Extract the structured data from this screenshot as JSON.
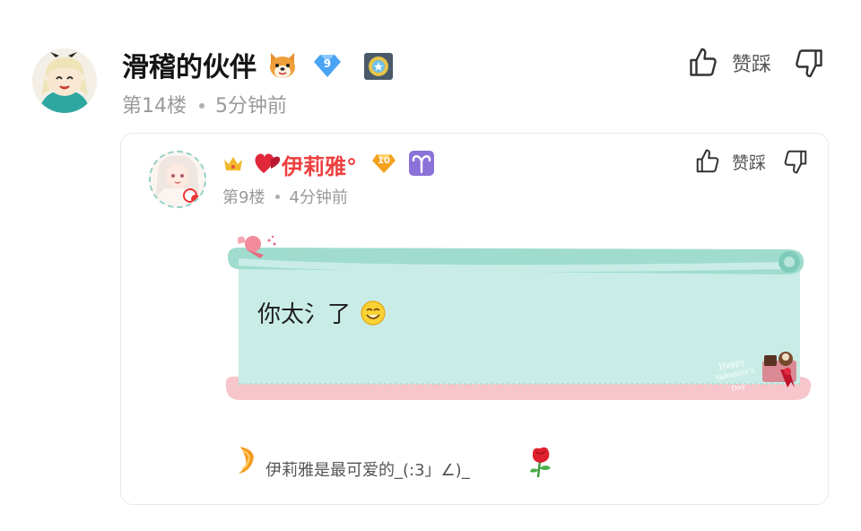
{
  "post": {
    "username": "滑稽的伙伴",
    "level": "9",
    "floor": "第14楼",
    "time": "5分钟前",
    "vote_label": "赞踩"
  },
  "reply": {
    "username": "伊莉雅°",
    "level": "10",
    "floor": "第9楼",
    "time": "4分钟前",
    "vote_label": "赞踩",
    "content": "你太氵了",
    "signature": "伊莉雅是最可爱的_(:3」∠)_"
  },
  "colors": {
    "username_red": "#ee3f3f",
    "meta_gray": "#9a9a9a",
    "bubble_mint": "#c9ede6",
    "bubble_pink": "#f6c6cc"
  }
}
